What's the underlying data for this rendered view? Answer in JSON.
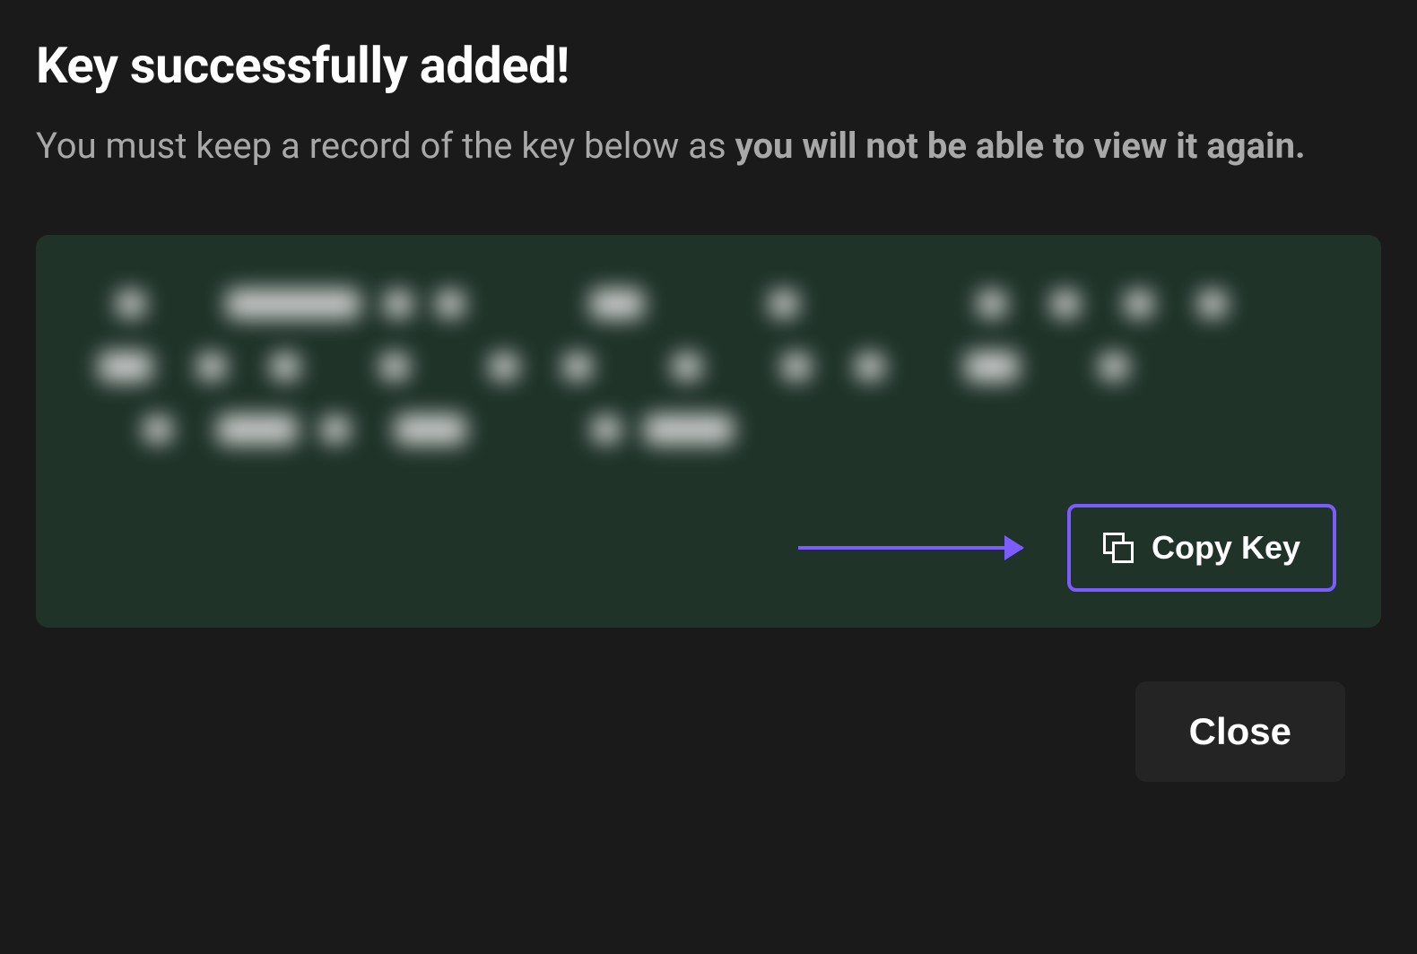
{
  "dialog": {
    "title": "Key successfully added!",
    "subtitle_prefix": "You must keep a record of the key below as ",
    "subtitle_bold": "you will not be able to view it again."
  },
  "actions": {
    "copy_key_label": "Copy Key",
    "close_label": "Close"
  },
  "annotation": {
    "arrow_color": "#7c5cff",
    "highlight_color": "#7c5cff"
  },
  "colors": {
    "background": "#1a1a1a",
    "key_box_bg": "#1f3329",
    "text_primary": "#ffffff",
    "text_secondary": "#a8a8a8"
  }
}
